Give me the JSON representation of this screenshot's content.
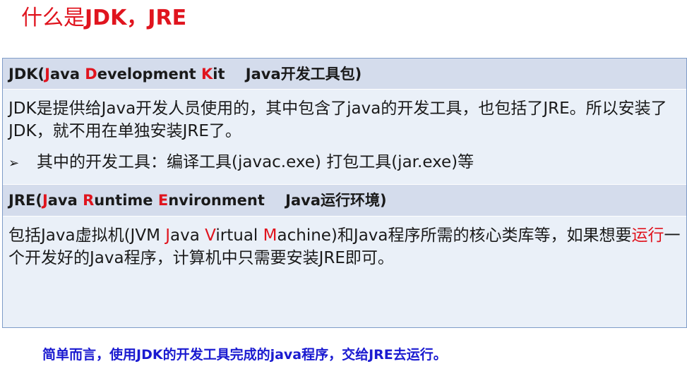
{
  "title": {
    "prefix": "什么是",
    "main": "JDK，JRE"
  },
  "jdk": {
    "header": {
      "open": "JDK(",
      "w1_initial": "J",
      "w1_rest": "ava ",
      "w2_initial": "D",
      "w2_rest": "evelopment ",
      "w3_initial": "K",
      "w3_rest": "it",
      "suffix": "Java开发工具包)"
    },
    "description": "JDK是提供给Java开发人员使用的，其中包含了java的开发工具，也包括了JRE。所以安装了JDK，就不用在单独安装JRE了。",
    "bullet_symbol": "➢",
    "bullet_text": "其中的开发工具：编译工具(javac.exe)  打包工具(jar.exe)等"
  },
  "jre": {
    "header": {
      "open": "JRE(",
      "w1_initial": "J",
      "w1_rest": "ava ",
      "w2_initial": "R",
      "w2_rest": "untime ",
      "w3_initial": "E",
      "w3_rest": "nvironment",
      "suffix": "Java运行环境)"
    },
    "description": {
      "part1": "包括Java虚拟机(JVM ",
      "jvm_j": "J",
      "jvm_j_rest": "ava ",
      "jvm_v": "V",
      "jvm_v_rest": "irtual ",
      "jvm_m": "M",
      "jvm_m_rest": "achine)和Java程序所需的核心类库等，如果想要",
      "highlight": "运行",
      "part2": "一个开发好的Java程序，计算机中只需要安装JRE即可。"
    }
  },
  "footer": "简单而言，使用JDK的开发工具完成的java程序，交给JRE去运行。",
  "colors": {
    "accent_red": "#e0141e",
    "footer_blue": "#1a1ad0",
    "header_bg": "#d4dcec",
    "body_bg": "#eaf0f8",
    "border": "#7f9cc8"
  }
}
